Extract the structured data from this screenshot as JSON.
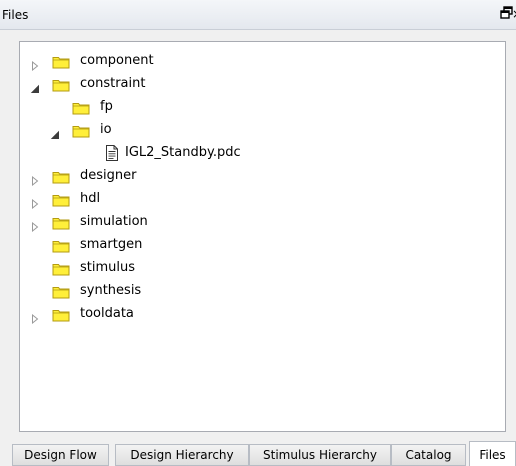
{
  "panel": {
    "title": "Files",
    "close_glyph": "×"
  },
  "tree": [
    {
      "label": "component",
      "state": "collapsed",
      "depth": 0,
      "kind": "folder",
      "icon": "folder-icon"
    },
    {
      "label": "constraint",
      "state": "expanded",
      "depth": 0,
      "kind": "folder",
      "icon": "folder-icon"
    },
    {
      "label": "fp",
      "state": "leaf",
      "depth": 1,
      "kind": "folder",
      "icon": "folder-icon"
    },
    {
      "label": "io",
      "state": "expanded",
      "depth": 1,
      "kind": "folder",
      "icon": "folder-icon"
    },
    {
      "label": "IGL2_Standby.pdc",
      "state": "leaf",
      "depth": 2,
      "kind": "file",
      "icon": "document-icon"
    },
    {
      "label": "designer",
      "state": "collapsed",
      "depth": 0,
      "kind": "folder",
      "icon": "folder-icon"
    },
    {
      "label": "hdl",
      "state": "collapsed",
      "depth": 0,
      "kind": "folder",
      "icon": "folder-icon"
    },
    {
      "label": "simulation",
      "state": "collapsed",
      "depth": 0,
      "kind": "folder",
      "icon": "folder-icon"
    },
    {
      "label": "smartgen",
      "state": "leaf",
      "depth": 0,
      "kind": "folder",
      "icon": "folder-icon"
    },
    {
      "label": "stimulus",
      "state": "leaf",
      "depth": 0,
      "kind": "folder",
      "icon": "folder-icon"
    },
    {
      "label": "synthesis",
      "state": "leaf",
      "depth": 0,
      "kind": "folder",
      "icon": "folder-icon"
    },
    {
      "label": "tooldata",
      "state": "collapsed",
      "depth": 0,
      "kind": "folder",
      "icon": "folder-icon"
    }
  ],
  "tabs": [
    {
      "label": "Design Flow",
      "active": false
    },
    {
      "label": "Design Hierarchy",
      "active": false
    },
    {
      "label": "Stimulus Hierarchy",
      "active": false
    },
    {
      "label": "Catalog",
      "active": false
    },
    {
      "label": "Files",
      "active": true
    }
  ],
  "colors": {
    "folder_fill": "#ffef3a",
    "folder_stroke": "#b39b12",
    "expander_collapsed": "#9a9a9a",
    "expander_expanded": "#3c3c3c"
  }
}
